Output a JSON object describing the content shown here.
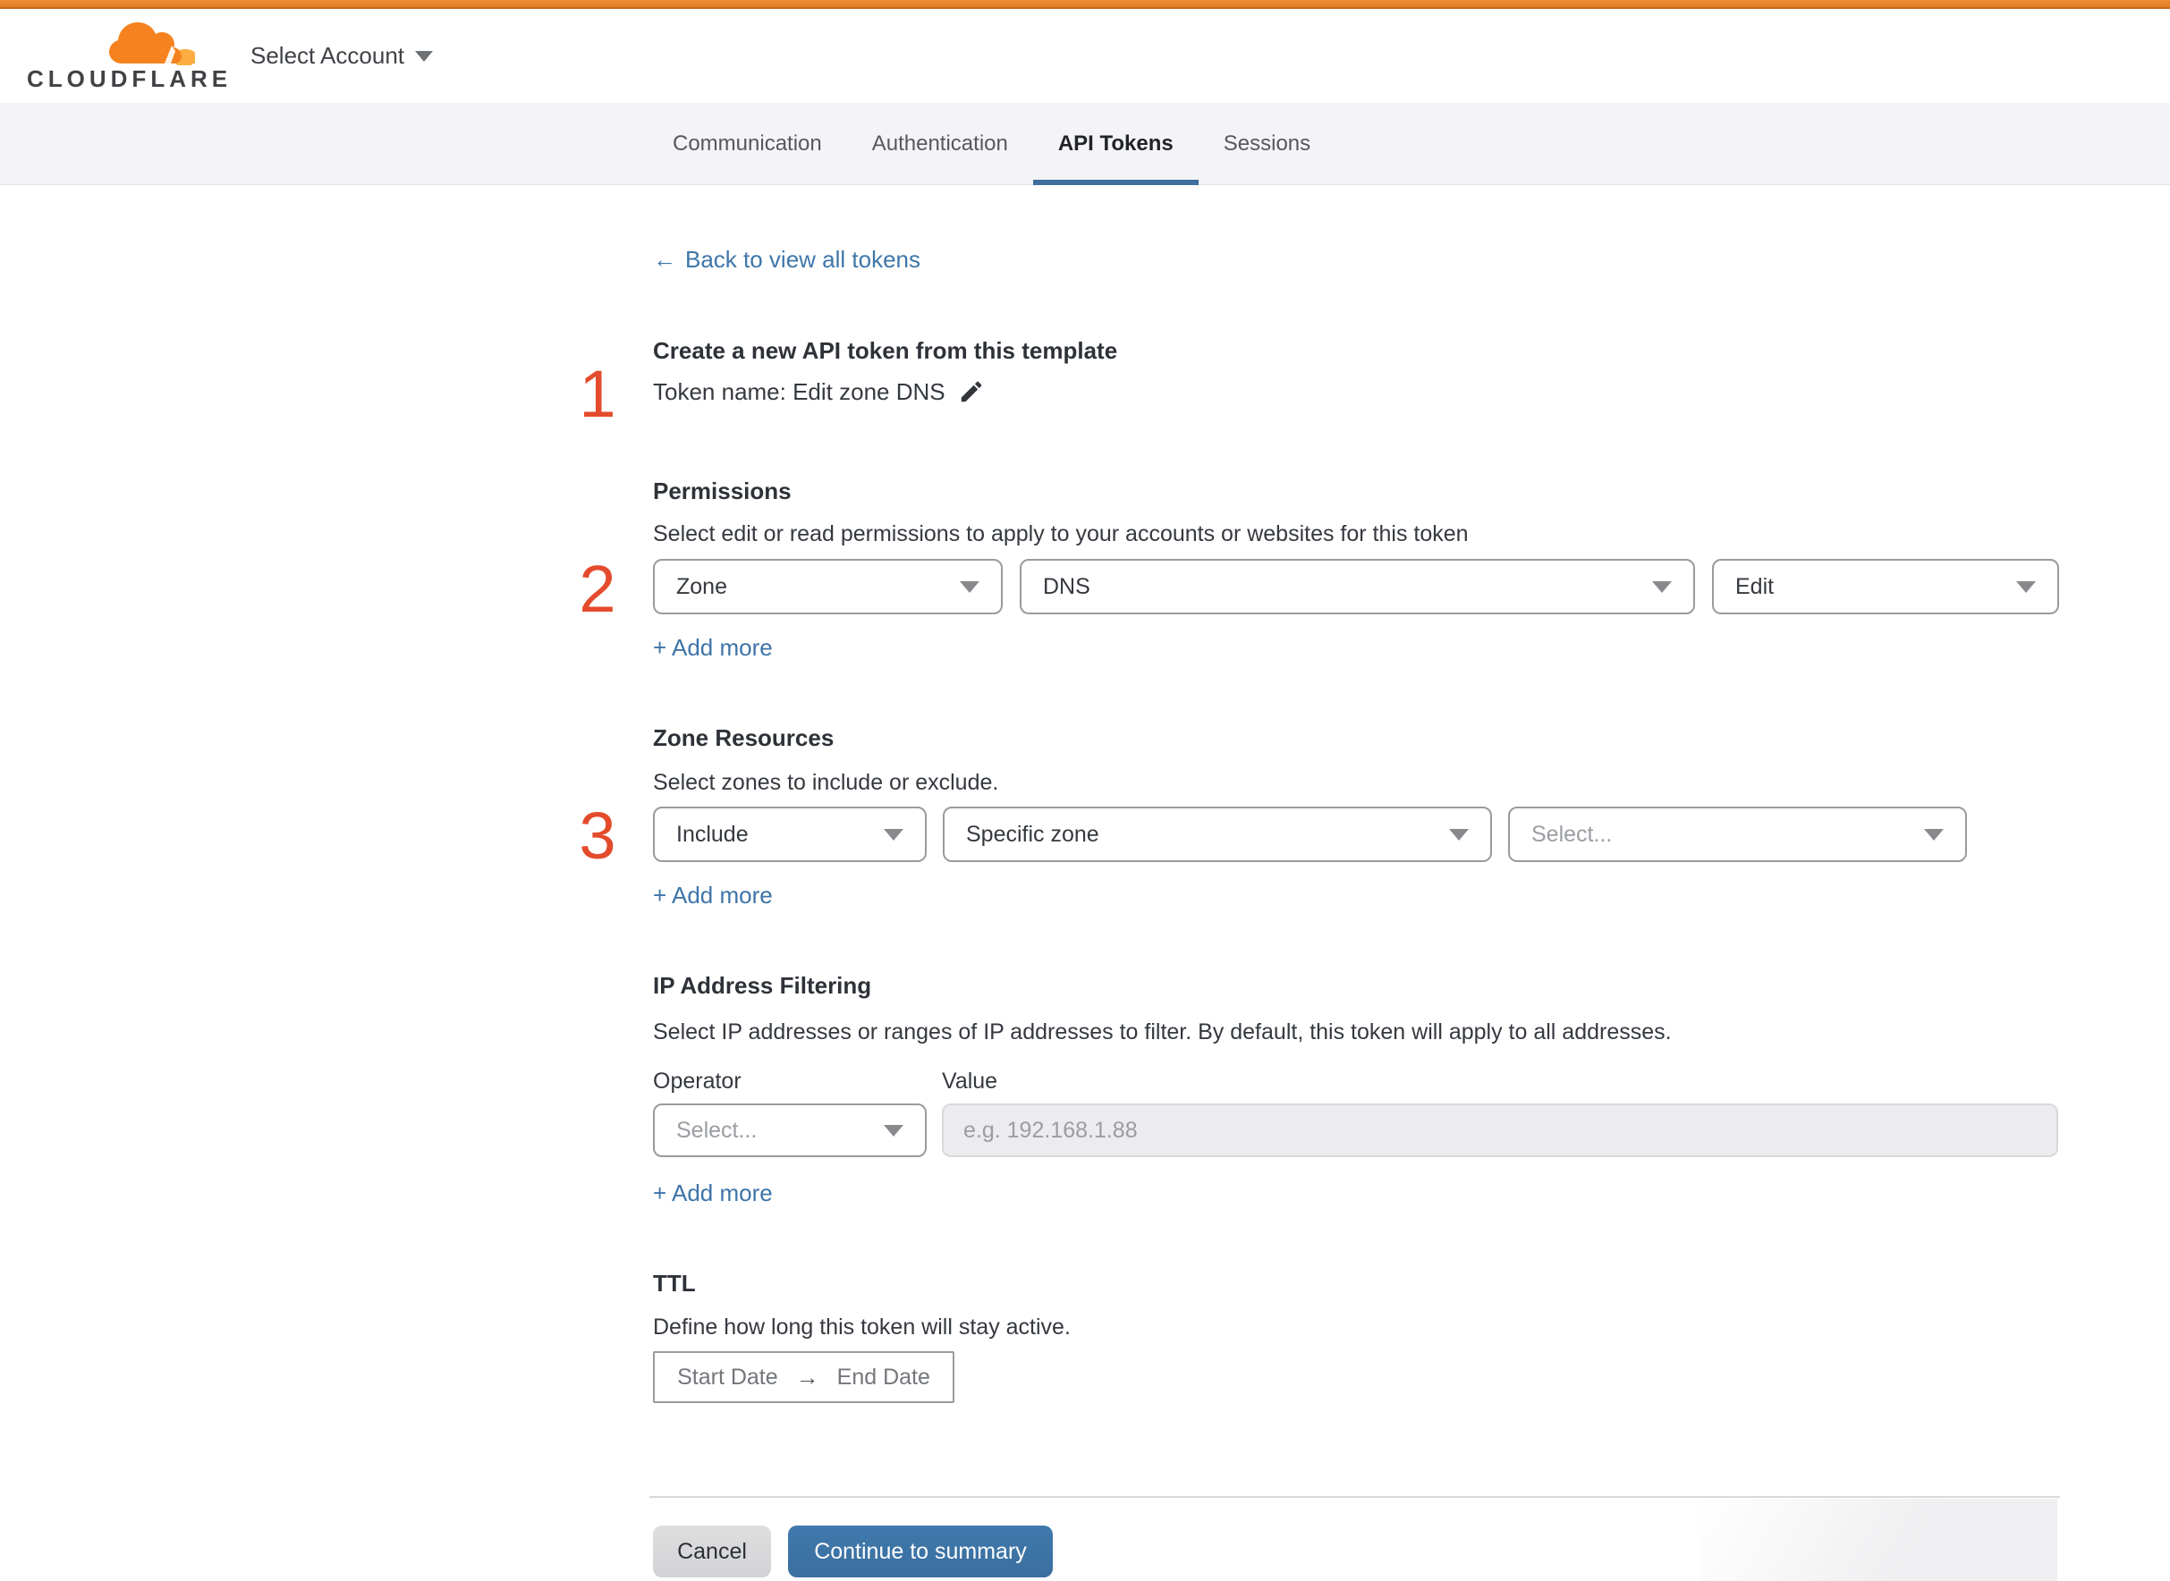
{
  "header": {
    "logo_wordmark": "CLOUDFLARE",
    "account_selector_label": "Select Account"
  },
  "tabs": {
    "items": [
      {
        "label": "Communication",
        "active": false
      },
      {
        "label": "Authentication",
        "active": false
      },
      {
        "label": "API Tokens",
        "active": true
      },
      {
        "label": "Sessions",
        "active": false
      }
    ]
  },
  "back_link": {
    "arrow": "←",
    "label": "Back to view all tokens"
  },
  "sections": {
    "template": {
      "step_number": "1",
      "title": "Create a new API token from this template",
      "token_name_label": "Token name: Edit zone DNS"
    },
    "permissions": {
      "step_number": "2",
      "title": "Permissions",
      "description": "Select edit or read permissions to apply to your accounts or websites for this token",
      "dropdowns": [
        {
          "value": "Zone",
          "is_placeholder": false
        },
        {
          "value": "DNS",
          "is_placeholder": false
        },
        {
          "value": "Edit",
          "is_placeholder": false
        }
      ],
      "add_more_label": "+ Add more"
    },
    "zone_resources": {
      "step_number": "3",
      "title": "Zone Resources",
      "description": "Select zones to include or exclude.",
      "dropdowns": [
        {
          "value": "Include",
          "is_placeholder": false
        },
        {
          "value": "Specific zone",
          "is_placeholder": false
        },
        {
          "value": "Select...",
          "is_placeholder": true
        }
      ],
      "add_more_label": "+ Add more"
    },
    "ip_filtering": {
      "title": "IP Address Filtering",
      "description": "Select IP addresses or ranges of IP addresses to filter. By default, this token will apply to all addresses.",
      "operator_label": "Operator",
      "value_label": "Value",
      "operator_dropdown_value": "Select...",
      "value_placeholder": "e.g. 192.168.1.88",
      "add_more_label": "+ Add more"
    },
    "ttl": {
      "title": "TTL",
      "description": "Define how long this token will stay active.",
      "start_date_label": "Start Date",
      "arrow": "→",
      "end_date_label": "End Date"
    }
  },
  "footer": {
    "cancel_label": "Cancel",
    "continue_label": "Continue to summary"
  },
  "colors": {
    "brand_orange": "#e8822d",
    "step_number_red": "#e34b2c",
    "link_blue": "#3e76a8",
    "tab_underline_blue": "#3e6f9e",
    "primary_button_blue": "#3c74a6",
    "tabbar_background": "#f4f4f6",
    "disabled_input_background": "#ececee"
  }
}
